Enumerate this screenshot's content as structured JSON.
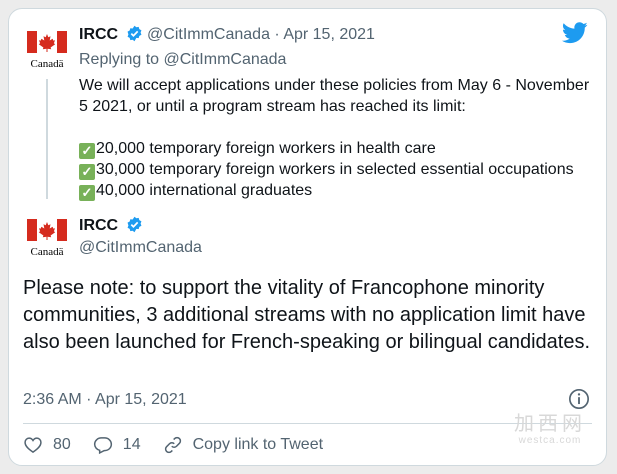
{
  "parent_tweet": {
    "name": "IRCC",
    "handle": "@CitImmCanada",
    "date": "Apr 15, 2021",
    "separator": "·",
    "replying_to": "Replying to @CitImmCanada",
    "text_intro": "We will accept applications under these policies from May 6 - November 5 2021, or until a program stream has reached its limit:",
    "items": [
      "20,000 temporary foreign workers in health care",
      "30,000 temporary foreign workers in selected essential occupations",
      "40,000 international graduates"
    ],
    "logo_text": "Canadä"
  },
  "main_tweet": {
    "name": "IRCC",
    "handle": "@CitImmCanada",
    "logo_text": "Canadä",
    "text": "Please note: to support the vitality of Francophone minority communities, 3 additional streams with no application limit have also been launched for French-speaking or bilingual candidates.",
    "timestamp": "2:36 AM · Apr 15, 2021"
  },
  "actions": {
    "likes": "80",
    "replies": "14",
    "copy_link": "Copy link to Tweet"
  },
  "watermark": {
    "main": "加西网",
    "sub": "westca.com"
  },
  "colors": {
    "twitter_blue": "#1d9bf0",
    "canada_red": "#d52b1e",
    "check_green": "#78b159",
    "muted_text": "#536471"
  }
}
